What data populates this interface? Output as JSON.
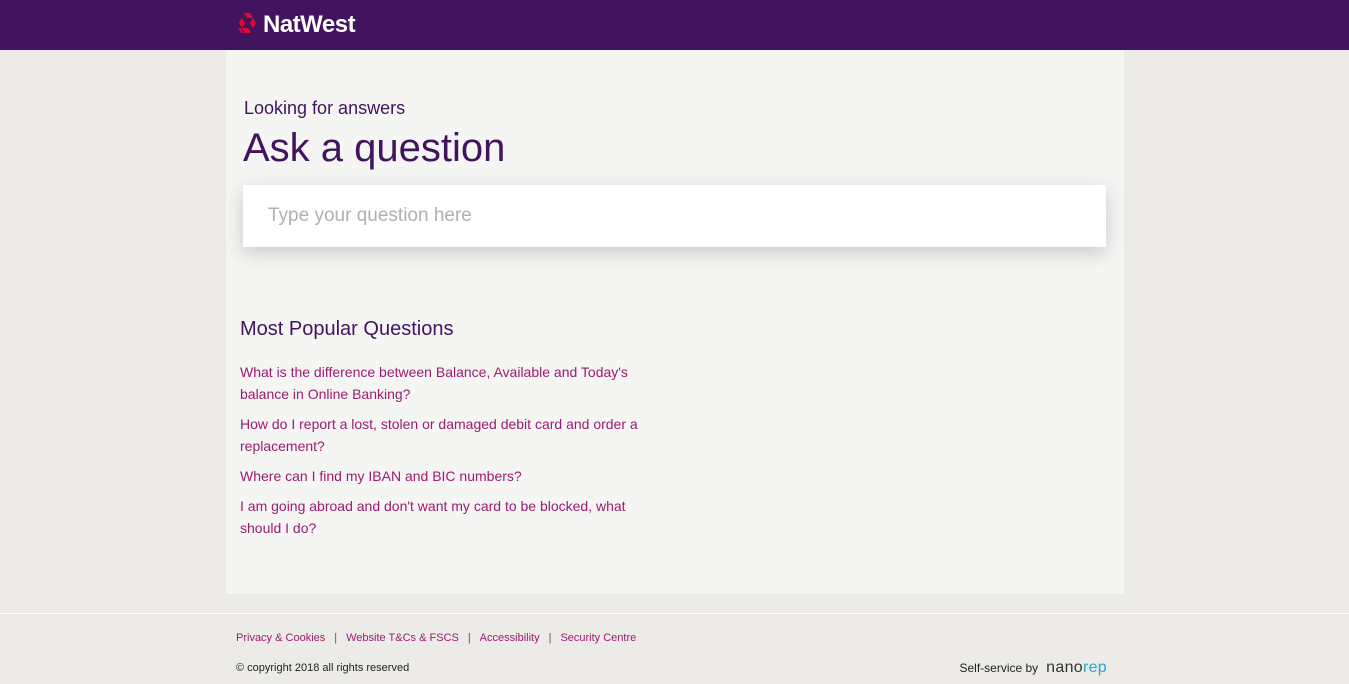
{
  "header": {
    "brand_name": "NatWest",
    "brand_color": "#42145f",
    "logo_color": "#e30a2e",
    "logo_icon": "natwest-cubes-icon"
  },
  "hero": {
    "eyebrow": "Looking for answers",
    "title": "Ask a question"
  },
  "search": {
    "placeholder": "Type your question here",
    "value": ""
  },
  "popular": {
    "title": "Most Popular Questions",
    "questions": [
      "What is the difference between Balance, Available and Today's balance in Online Banking?",
      "How do I report a lost, stolen or damaged debit card and order a replacement?",
      "Where can I find my IBAN and BIC numbers?",
      "I am going abroad and don't want my card to be blocked, what should I do?"
    ]
  },
  "footer": {
    "links": [
      "Privacy & Cookies",
      "Website T&Cs & FSCS",
      "Accessibility",
      "Security Centre"
    ],
    "separator": "|",
    "copyright": "© copyright 2018 all rights reserved",
    "powered_by_label": "Self-service by",
    "powered_by_brand_part1": "nano",
    "powered_by_brand_part2": "rep",
    "link_color": "#9b1b73"
  }
}
